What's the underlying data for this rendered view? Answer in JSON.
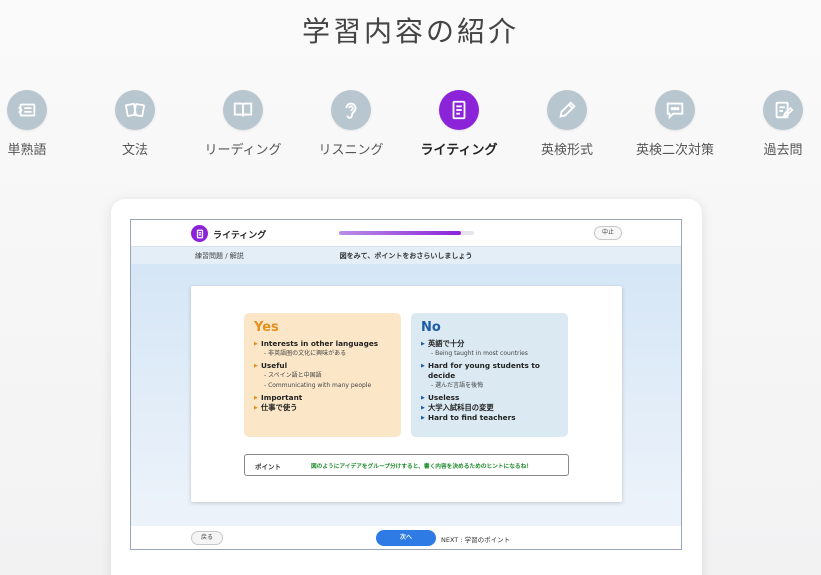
{
  "page": {
    "title": "学習内容の紹介"
  },
  "categories": [
    {
      "label": "単熟語",
      "icon": "vocabulary-card-icon"
    },
    {
      "label": "文法",
      "icon": "grammar-cards-icon"
    },
    {
      "label": "リーディング",
      "icon": "book-icon"
    },
    {
      "label": "リスニング",
      "icon": "ear-icon"
    },
    {
      "label": "ライティング",
      "icon": "document-icon",
      "active": true
    },
    {
      "label": "英検形式",
      "icon": "pencil-icon"
    },
    {
      "label": "英検二次対策",
      "icon": "speech-bubble-icon"
    },
    {
      "label": "過去問",
      "icon": "edit-document-icon"
    }
  ],
  "lesson": {
    "title": "ライティング",
    "progress_fraction": 0.9,
    "stop_label": "中止",
    "section_label": "練習問題 / 解説",
    "instruction": "図をみて、ポイントをおさらいしましょう",
    "yes": {
      "heading": "Yes",
      "items": [
        {
          "text": "Interests in other languages",
          "subs": [
            "- 非英語圏の文化に興味がある"
          ]
        },
        {
          "text": "Useful",
          "subs": [
            "- スペイン語と中国語",
            "- Communicating with many people"
          ]
        },
        {
          "text": "Important",
          "subs": []
        },
        {
          "text": "仕事で使う",
          "subs": []
        }
      ]
    },
    "no": {
      "heading": "No",
      "items": [
        {
          "text": "英語で十分",
          "subs": [
            "- Being taught in most countries"
          ]
        },
        {
          "text": "Hard for young students to decide",
          "subs": [
            "- 選んだ言語を後悔"
          ]
        },
        {
          "text": "Useless",
          "subs": []
        },
        {
          "text": "大学入試科目の変更",
          "subs": []
        },
        {
          "text": "Hard to find teachers",
          "subs": []
        }
      ]
    },
    "point": {
      "label": "ポイント",
      "text": "図のようにアイデアをグループ分けすると、書く内容を決めるためのヒントになるね！"
    },
    "back_label": "戻る",
    "next_label": "次へ",
    "next_preview": "NEXT : 学習のポイント"
  },
  "colors": {
    "accent_purple": "#8b24d9",
    "icon_gray": "#b8c6cf",
    "yes_orange": "#e39021",
    "no_blue": "#1c5ba6",
    "next_blue": "#2e7be6",
    "point_green": "#1d8a2a"
  }
}
